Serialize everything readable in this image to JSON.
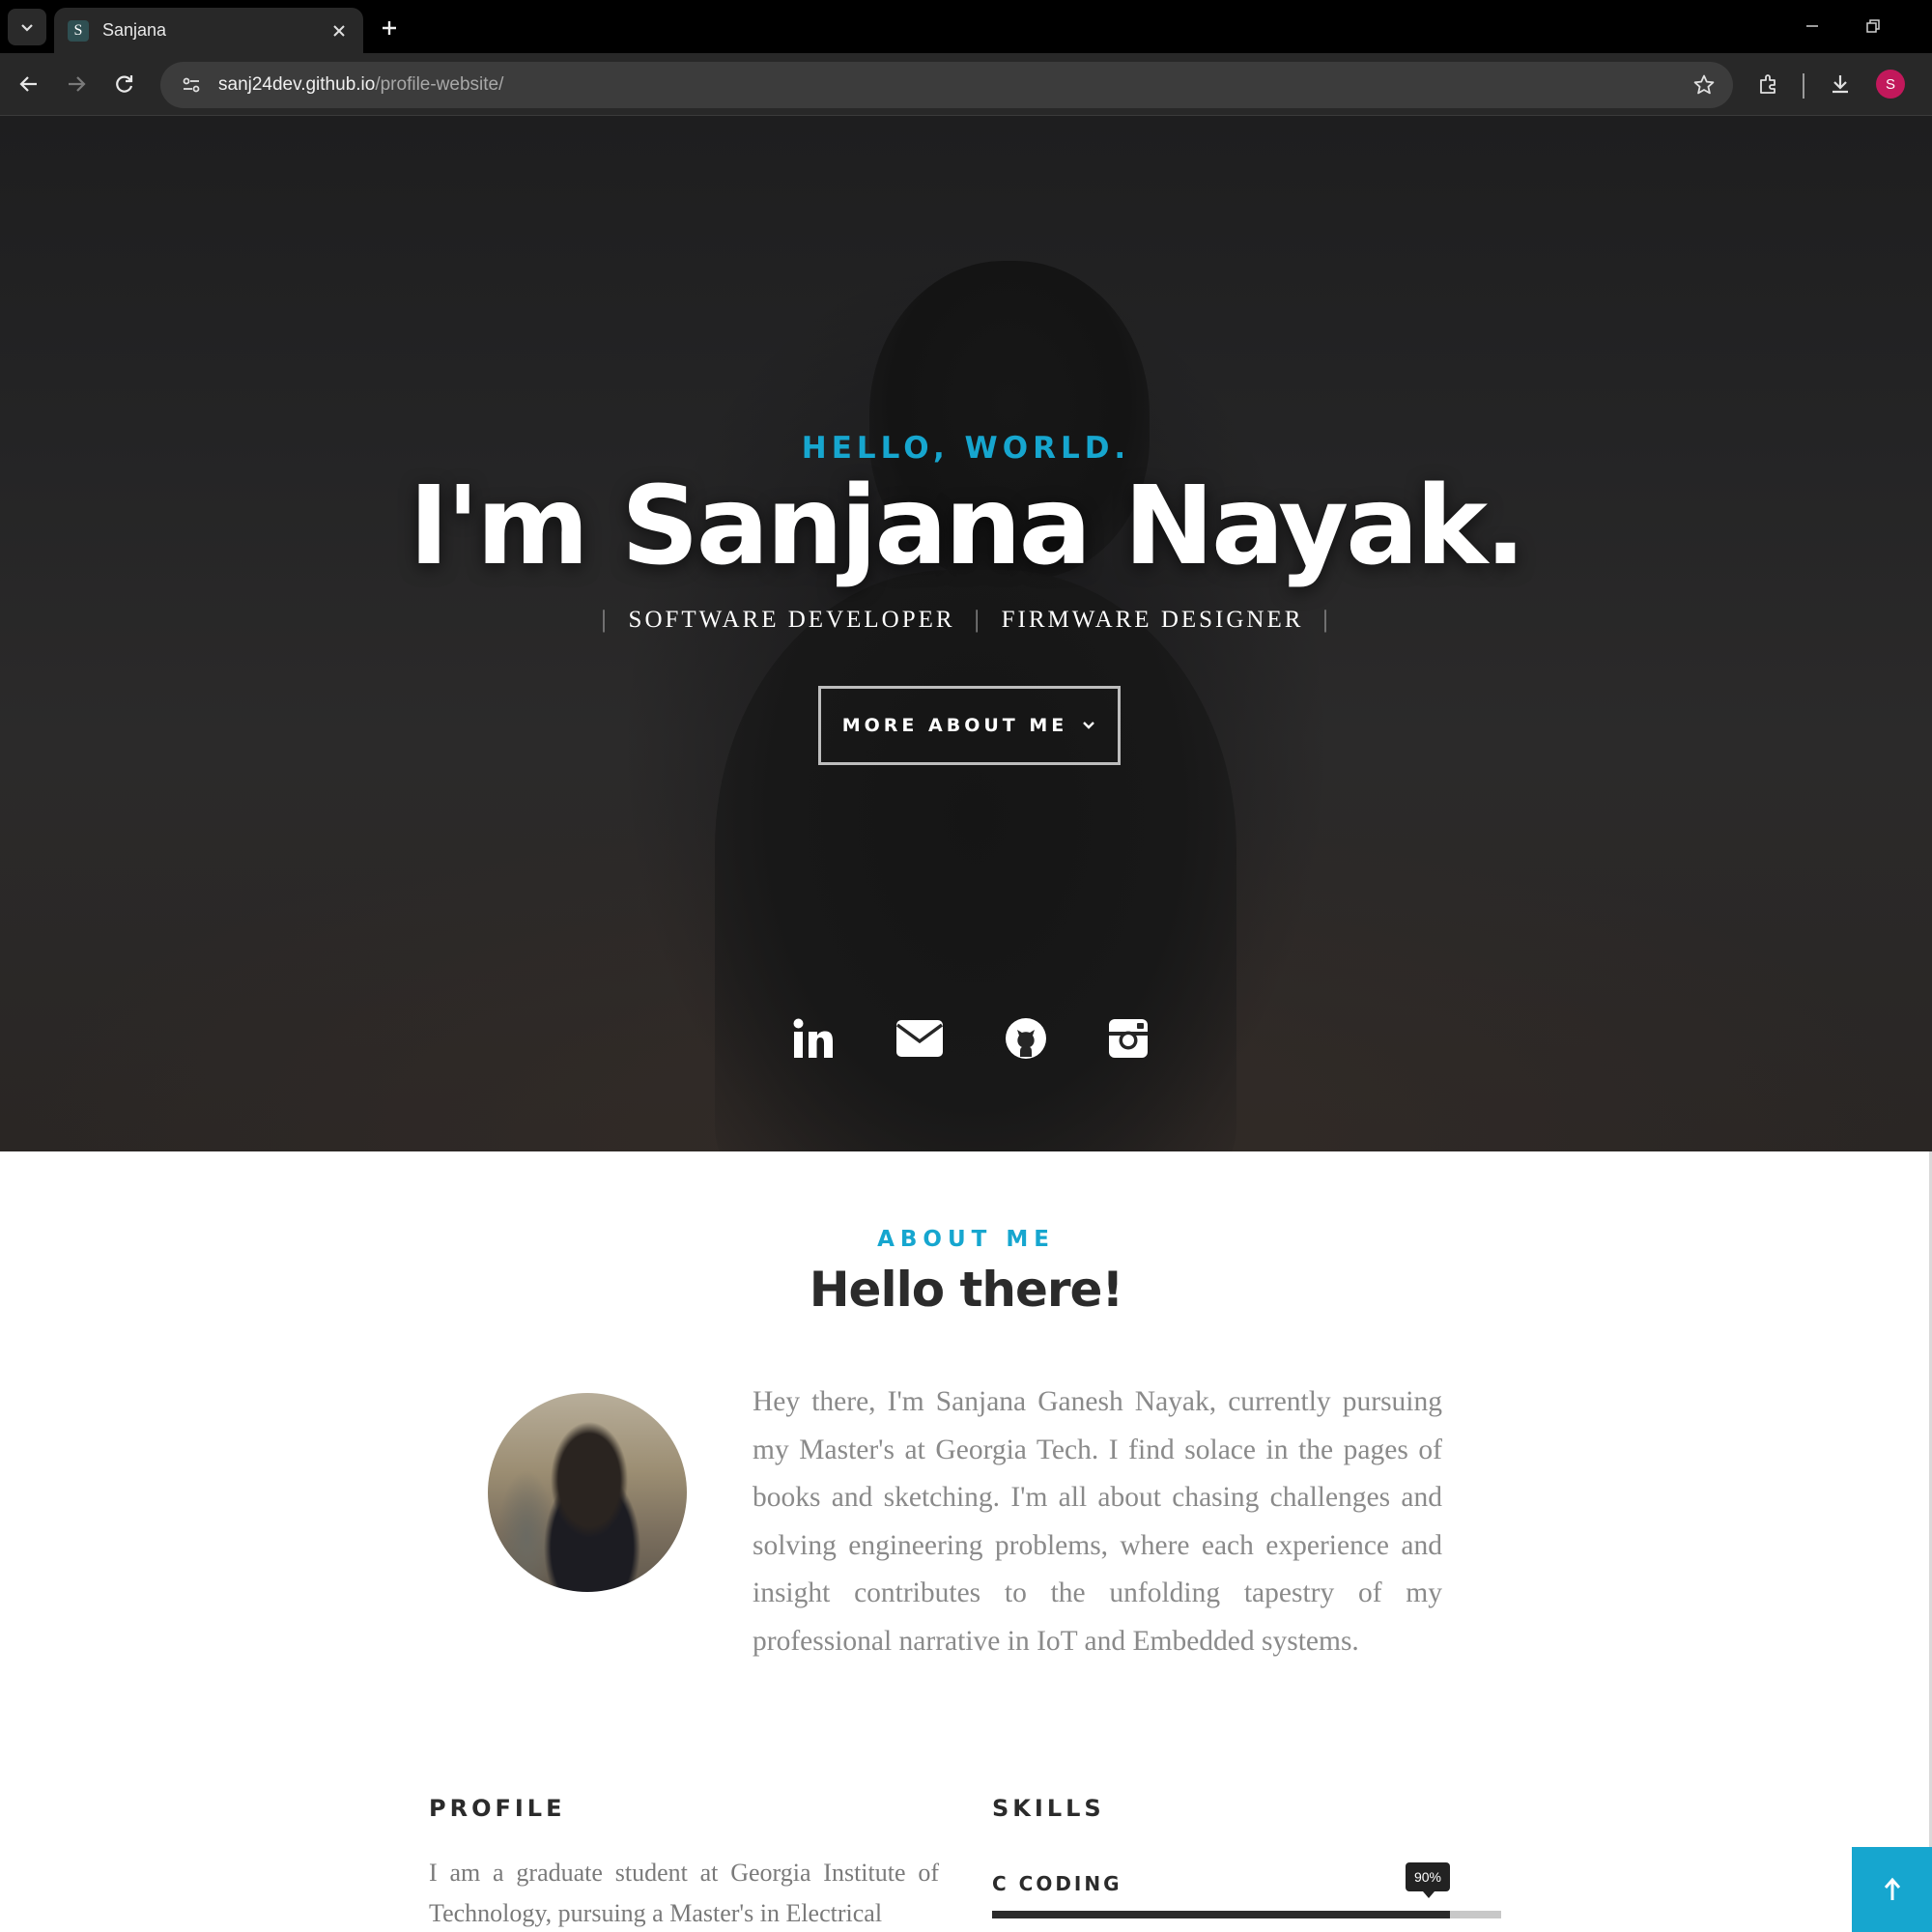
{
  "browser": {
    "tab": {
      "favicon_letter": "S",
      "title": "Sanjana"
    },
    "url": {
      "host": "sanj24dev.github.io",
      "path": "/profile-website/"
    },
    "profile_initial": "S",
    "icons": [
      "tab-list-icon",
      "close-icon",
      "plus-icon",
      "minimize-icon",
      "restore-icon",
      "back-arrow-icon",
      "forward-arrow-icon",
      "reload-icon",
      "site-info-icon",
      "star-icon",
      "extensions-icon",
      "download-icon"
    ]
  },
  "hero": {
    "kicker": "HELLO, WORLD.",
    "name": "I'm Sanjana Nayak.",
    "roles": [
      "SOFTWARE DEVELOPER",
      "FIRMWARE DESIGNER"
    ],
    "button_label": "MORE ABOUT ME",
    "socials": [
      "linkedin-icon",
      "email-icon",
      "github-icon",
      "instagram-icon"
    ]
  },
  "about": {
    "kicker": "ABOUT ME",
    "heading": "Hello there!",
    "bio": "Hey there, I'm Sanjana Ganesh Nayak, currently pursuing my Master's at Georgia Tech. I find solace in the pages of books and sketching. I'm all about chasing challenges and solving engineering problems, where each experience and insight contributes to the unfolding tapestry of my professional narrative in IoT and Embedded systems.",
    "profile": {
      "title": "PROFILE",
      "text": "I am a graduate student at Georgia Institute of Technology, pursuing a Master's in Electrical"
    },
    "skills": {
      "title": "SKILLS",
      "items": [
        {
          "name": "C CODING",
          "percent_label": "90%",
          "level": 0.9
        }
      ]
    }
  },
  "colors": {
    "accent": "#16a6cf",
    "heading": "#2b2b2b",
    "body_text": "#8a8a8a"
  }
}
